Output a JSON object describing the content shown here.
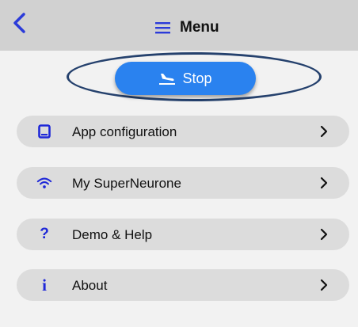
{
  "header": {
    "title": "Menu",
    "back_icon": "chevron-left-icon",
    "menu_icon": "hamburger-icon",
    "back_color": "#2b3bd9"
  },
  "stop_button": {
    "label": "Stop",
    "icon": "airplane-landing-icon",
    "color": "#2a82ef",
    "highlight_ring_color": "#25416d"
  },
  "menu": {
    "items": [
      {
        "label": "App configuration",
        "icon": "tablet-icon"
      },
      {
        "label": "My SuperNeurone",
        "icon": "wifi-icon"
      },
      {
        "label": "Demo & Help",
        "icon": "question-mark-icon",
        "icon_glyph": "?"
      },
      {
        "label": "About",
        "icon": "info-icon",
        "icon_glyph": "i"
      }
    ],
    "icon_color": "#1f28d8",
    "item_background": "#dcdcdc"
  }
}
